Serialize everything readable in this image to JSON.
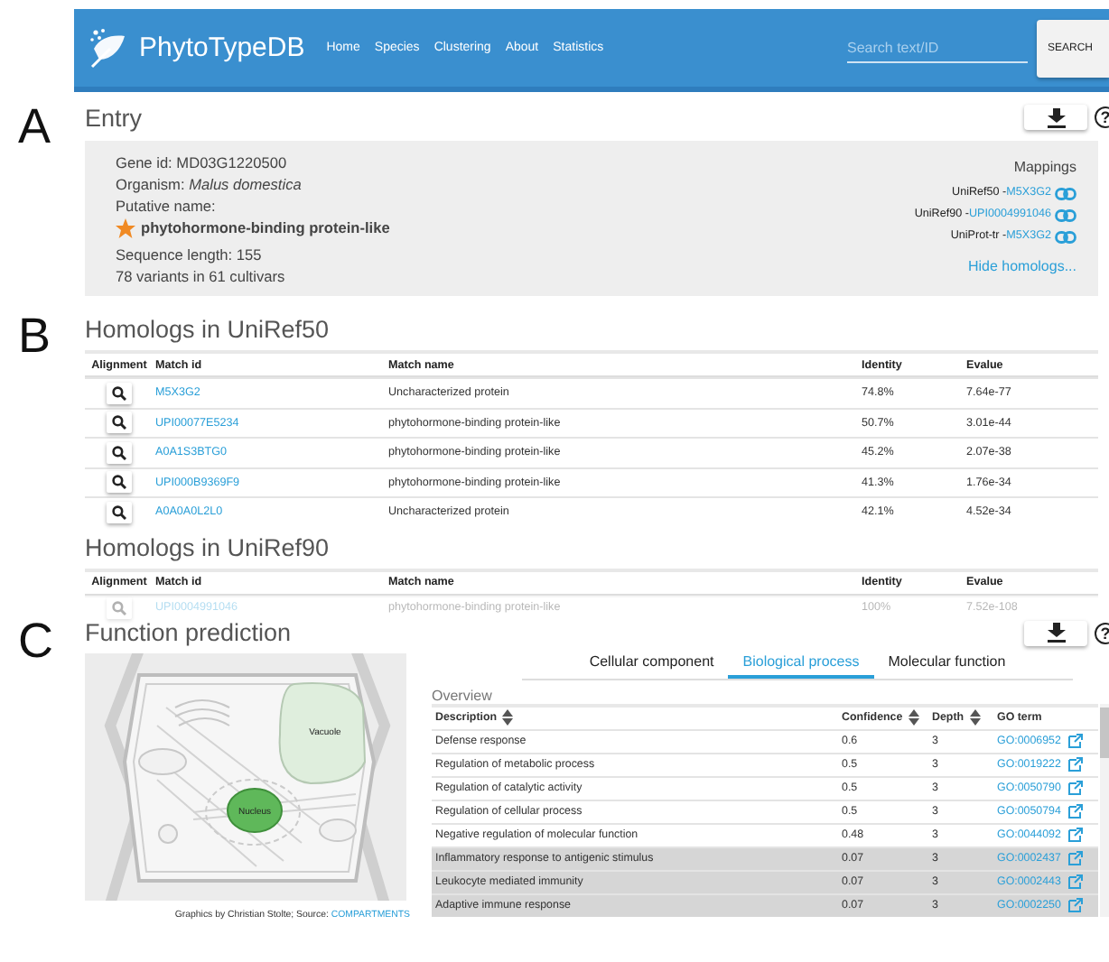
{
  "navbar": {
    "brand": "PhytoTypeDB",
    "links": [
      "Home",
      "Species",
      "Clustering",
      "About",
      "Statistics"
    ],
    "search": {
      "placeholder": "Search text/ID",
      "button": "SEARCH"
    }
  },
  "entry": {
    "panel_label": "A",
    "title": "Entry",
    "help": "?",
    "lines": [
      {
        "kind": "plain",
        "text": "Gene id: MD03G1220500"
      },
      {
        "kind": "plain",
        "text": "Organism: *Malus domestica*"
      },
      {
        "kind": "plain",
        "text": "Putative name:"
      },
      {
        "kind": "starred",
        "text": "phytohormone-binding protein-like"
      },
      {
        "kind": "gap",
        "text": "Sequence length: 155"
      },
      {
        "kind": "plain",
        "text": "78 variants in 61 cultivars"
      }
    ],
    "mappings": {
      "title": "Mappings",
      "items": [
        {
          "source": "UniRef50 - ",
          "id": "M5X3G2"
        },
        {
          "source": "UniRef90 - ",
          "id": "UPI0004991046"
        },
        {
          "source": "UniProt-tr - ",
          "id": "M5X3G2"
        }
      ],
      "toggle": "Hide homologs..."
    }
  },
  "homologs": [
    {
      "panel_label": "B",
      "title": "Homologs in UniRef50",
      "columns": [
        "Alignment",
        "Match id",
        "Match name",
        "Identity",
        "Evalue"
      ],
      "rows": [
        {
          "match_id": "M5X3G2",
          "match_name": "Uncharacterized protein",
          "identity": "74.8%",
          "evalue": "7.64e-77",
          "faded": false
        },
        {
          "match_id": "UPI00077E5234",
          "match_name": "phytohormone-binding protein-like",
          "identity": "50.7%",
          "evalue": "3.01e-44",
          "faded": false
        },
        {
          "match_id": "A0A1S3BTG0",
          "match_name": "phytohormone-binding protein-like",
          "identity": "45.2%",
          "evalue": "2.07e-38",
          "faded": false
        },
        {
          "match_id": "UPI000B9369F9",
          "match_name": "phytohormone-binding protein-like",
          "identity": "41.3%",
          "evalue": "1.76e-34",
          "faded": false
        },
        {
          "match_id": "A0A0A0L2L0",
          "match_name": "Uncharacterized protein",
          "identity": "42.1%",
          "evalue": "4.52e-34",
          "faded": false
        }
      ]
    },
    {
      "title": "Homologs in UniRef90",
      "columns": [
        "Alignment",
        "Match id",
        "Match name",
        "Identity",
        "Evalue"
      ],
      "rows": [
        {
          "match_id": "UPI0004991046",
          "match_name": "phytohormone-binding protein-like",
          "identity": "100%",
          "evalue": "7.52e-108",
          "faded": true
        }
      ]
    }
  ],
  "function_prediction": {
    "panel_label": "C",
    "title": "Function prediction",
    "help": "?",
    "diagram": {
      "labels": [
        "Vacuole",
        "Nucleus"
      ],
      "caption": "Graphics by Christian Stolte; Source: ",
      "caption_link": "COMPARTMENTS"
    },
    "tabs": [
      {
        "label": "Cellular component",
        "selected": false
      },
      {
        "label": "Biological process",
        "selected": true
      },
      {
        "label": "Molecular function",
        "selected": false
      }
    ],
    "overview": "Overview",
    "columns": [
      "Description",
      "Confidence",
      "Depth",
      "GO term"
    ],
    "rows": [
      {
        "description": "Defense response",
        "confidence": "0.6",
        "depth": "3",
        "go_term": "GO:0006952",
        "shaded": false
      },
      {
        "description": "Regulation of metabolic process",
        "confidence": "0.5",
        "depth": "3",
        "go_term": "GO:0019222",
        "shaded": false
      },
      {
        "description": "Regulation of catalytic activity",
        "confidence": "0.5",
        "depth": "3",
        "go_term": "GO:0050790",
        "shaded": false
      },
      {
        "description": "Regulation of cellular process",
        "confidence": "0.5",
        "depth": "3",
        "go_term": "GO:0050794",
        "shaded": false
      },
      {
        "description": "Negative regulation of molecular function",
        "confidence": "0.48",
        "depth": "3",
        "go_term": "GO:0044092",
        "shaded": false
      },
      {
        "description": "Inflammatory response to antigenic stimulus",
        "confidence": "0.07",
        "depth": "3",
        "go_term": "GO:0002437",
        "shaded": true
      },
      {
        "description": "Leukocyte mediated immunity",
        "confidence": "0.07",
        "depth": "3",
        "go_term": "GO:0002443",
        "shaded": true
      },
      {
        "description": "Adaptive immune response",
        "confidence": "0.07",
        "depth": "3",
        "go_term": "GO:0002250",
        "shaded": true
      }
    ]
  }
}
